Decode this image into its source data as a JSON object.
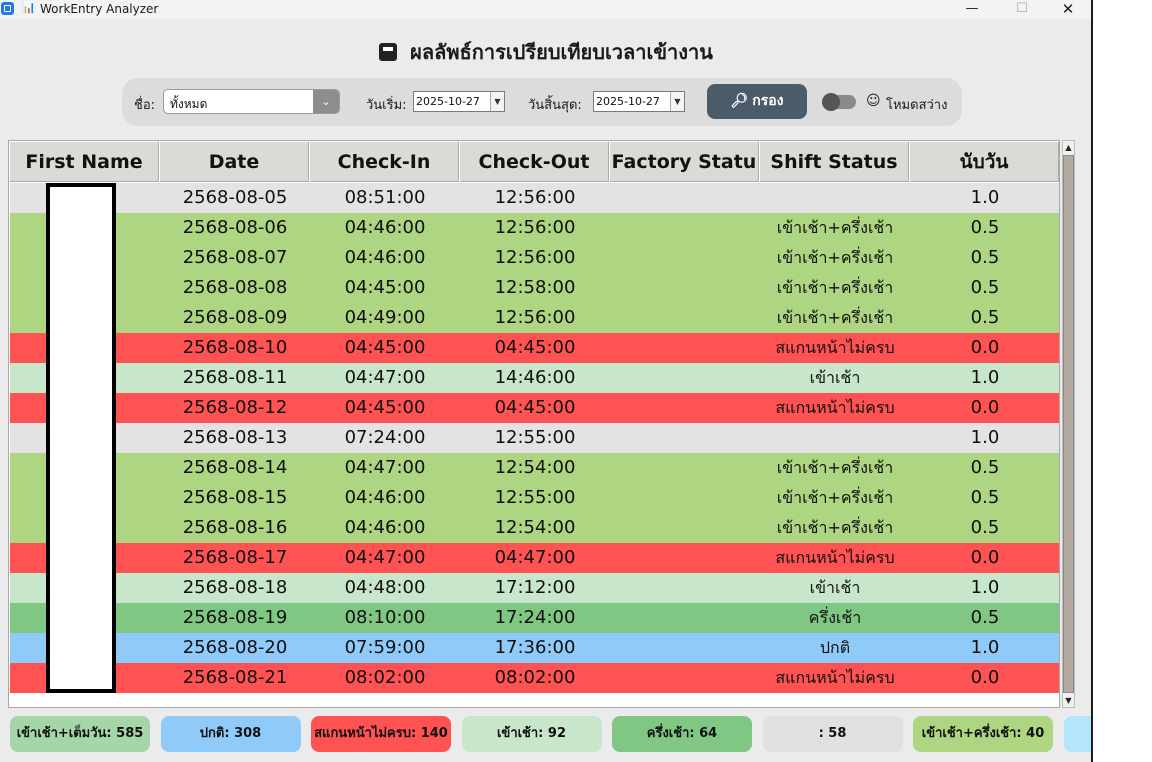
{
  "window": {
    "title": "WorkEntry Analyzer",
    "minimize": "—",
    "maximize": "☐",
    "close": "✕"
  },
  "page": {
    "title": "ผลลัพธ์การเปรียบเทียบเวลาเข้างาน",
    "title_icon": "inbox-tray-icon"
  },
  "filters": {
    "name_label": "ชื่อ:",
    "name_value": "ทั้งหมด",
    "start_label": "วันเริ่ม:",
    "start_value": "2025-10-27",
    "end_label": "วันสิ้นสุด:",
    "end_value": "2025-10-27",
    "filter_button": "กรอง",
    "filter_icon": "magnifier-icon",
    "mode_label": "โหมดสว่าง",
    "mode_icon": "smiley-icon"
  },
  "table": {
    "columns": [
      "First Name",
      "Date",
      "Check-In",
      "Check-Out",
      "Factory Statu",
      "Shift Status",
      "นับวัน"
    ],
    "rows": [
      {
        "first_name": "",
        "date": "2568-08-05",
        "check_in": "08:51:00",
        "check_out": "12:56:00",
        "factory_status": "",
        "shift_status": "",
        "day_count": "1.0",
        "color": "#e3e3e3"
      },
      {
        "first_name": "",
        "date": "2568-08-06",
        "check_in": "04:46:00",
        "check_out": "12:56:00",
        "factory_status": "",
        "shift_status": "เข้าเช้า+ครึ่งเช้า",
        "day_count": "0.5",
        "color": "#aed581"
      },
      {
        "first_name": "",
        "date": "2568-08-07",
        "check_in": "04:46:00",
        "check_out": "12:56:00",
        "factory_status": "",
        "shift_status": "เข้าเช้า+ครึ่งเช้า",
        "day_count": "0.5",
        "color": "#aed581"
      },
      {
        "first_name": "",
        "date": "2568-08-08",
        "check_in": "04:45:00",
        "check_out": "12:58:00",
        "factory_status": "",
        "shift_status": "เข้าเช้า+ครึ่งเช้า",
        "day_count": "0.5",
        "color": "#aed581"
      },
      {
        "first_name": "",
        "date": "2568-08-09",
        "check_in": "04:49:00",
        "check_out": "12:56:00",
        "factory_status": "",
        "shift_status": "เข้าเช้า+ครึ่งเช้า",
        "day_count": "0.5",
        "color": "#aed581"
      },
      {
        "first_name": "",
        "date": "2568-08-10",
        "check_in": "04:45:00",
        "check_out": "04:45:00",
        "factory_status": "",
        "shift_status": "สแกนหน้าไม่ครบ",
        "day_count": "0.0",
        "color": "#ff5252"
      },
      {
        "first_name": "",
        "date": "2568-08-11",
        "check_in": "04:47:00",
        "check_out": "14:46:00",
        "factory_status": "",
        "shift_status": "เข้าเช้า",
        "day_count": "1.0",
        "color": "#c8e6c9"
      },
      {
        "first_name": "",
        "date": "2568-08-12",
        "check_in": "04:45:00",
        "check_out": "04:45:00",
        "factory_status": "",
        "shift_status": "สแกนหน้าไม่ครบ",
        "day_count": "0.0",
        "color": "#ff5252"
      },
      {
        "first_name": "",
        "date": "2568-08-13",
        "check_in": "07:24:00",
        "check_out": "12:55:00",
        "factory_status": "",
        "shift_status": "",
        "day_count": "1.0",
        "color": "#e3e3e3"
      },
      {
        "first_name": "",
        "date": "2568-08-14",
        "check_in": "04:47:00",
        "check_out": "12:54:00",
        "factory_status": "",
        "shift_status": "เข้าเช้า+ครึ่งเช้า",
        "day_count": "0.5",
        "color": "#aed581"
      },
      {
        "first_name": "",
        "date": "2568-08-15",
        "check_in": "04:46:00",
        "check_out": "12:55:00",
        "factory_status": "",
        "shift_status": "เข้าเช้า+ครึ่งเช้า",
        "day_count": "0.5",
        "color": "#aed581"
      },
      {
        "first_name": "",
        "date": "2568-08-16",
        "check_in": "04:46:00",
        "check_out": "12:54:00",
        "factory_status": "",
        "shift_status": "เข้าเช้า+ครึ่งเช้า",
        "day_count": "0.5",
        "color": "#aed581"
      },
      {
        "first_name": "",
        "date": "2568-08-17",
        "check_in": "04:47:00",
        "check_out": "04:47:00",
        "factory_status": "",
        "shift_status": "สแกนหน้าไม่ครบ",
        "day_count": "0.0",
        "color": "#ff5252"
      },
      {
        "first_name": "",
        "date": "2568-08-18",
        "check_in": "04:48:00",
        "check_out": "17:12:00",
        "factory_status": "",
        "shift_status": "เข้าเช้า",
        "day_count": "1.0",
        "color": "#c8e6c9"
      },
      {
        "first_name": "",
        "date": "2568-08-19",
        "check_in": "08:10:00",
        "check_out": "17:24:00",
        "factory_status": "",
        "shift_status": "ครึ่งเช้า",
        "day_count": "0.5",
        "color": "#81c784"
      },
      {
        "first_name": "",
        "date": "2568-08-20",
        "check_in": "07:59:00",
        "check_out": "17:36:00",
        "factory_status": "",
        "shift_status": "ปกติ",
        "day_count": "1.0",
        "color": "#90caf9"
      },
      {
        "first_name": "",
        "date": "2568-08-21",
        "check_in": "08:02:00",
        "check_out": "08:02:00",
        "factory_status": "",
        "shift_status": "สแกนหน้าไม่ครบ",
        "day_count": "0.0",
        "color": "#ff5252"
      }
    ]
  },
  "summary": [
    {
      "text": "เข้าเช้า+เต็มวัน: 585",
      "color": "#a5d6a7"
    },
    {
      "text": "ปกติ: 308",
      "color": "#90caf9"
    },
    {
      "text": "สแกนหน้าไม่ครบ: 140",
      "color": "#ff5252"
    },
    {
      "text": "เข้าเช้า: 92",
      "color": "#c8e6c9"
    },
    {
      "text": "ครึ่งเช้า: 64",
      "color": "#81c784"
    },
    {
      "text": ": 58",
      "color": "#e0e0e0"
    },
    {
      "text": "เข้าเช้า+ครึ่งเช้า: 40",
      "color": "#aed581"
    },
    {
      "text": "",
      "color": "#b3e5fc"
    }
  ]
}
